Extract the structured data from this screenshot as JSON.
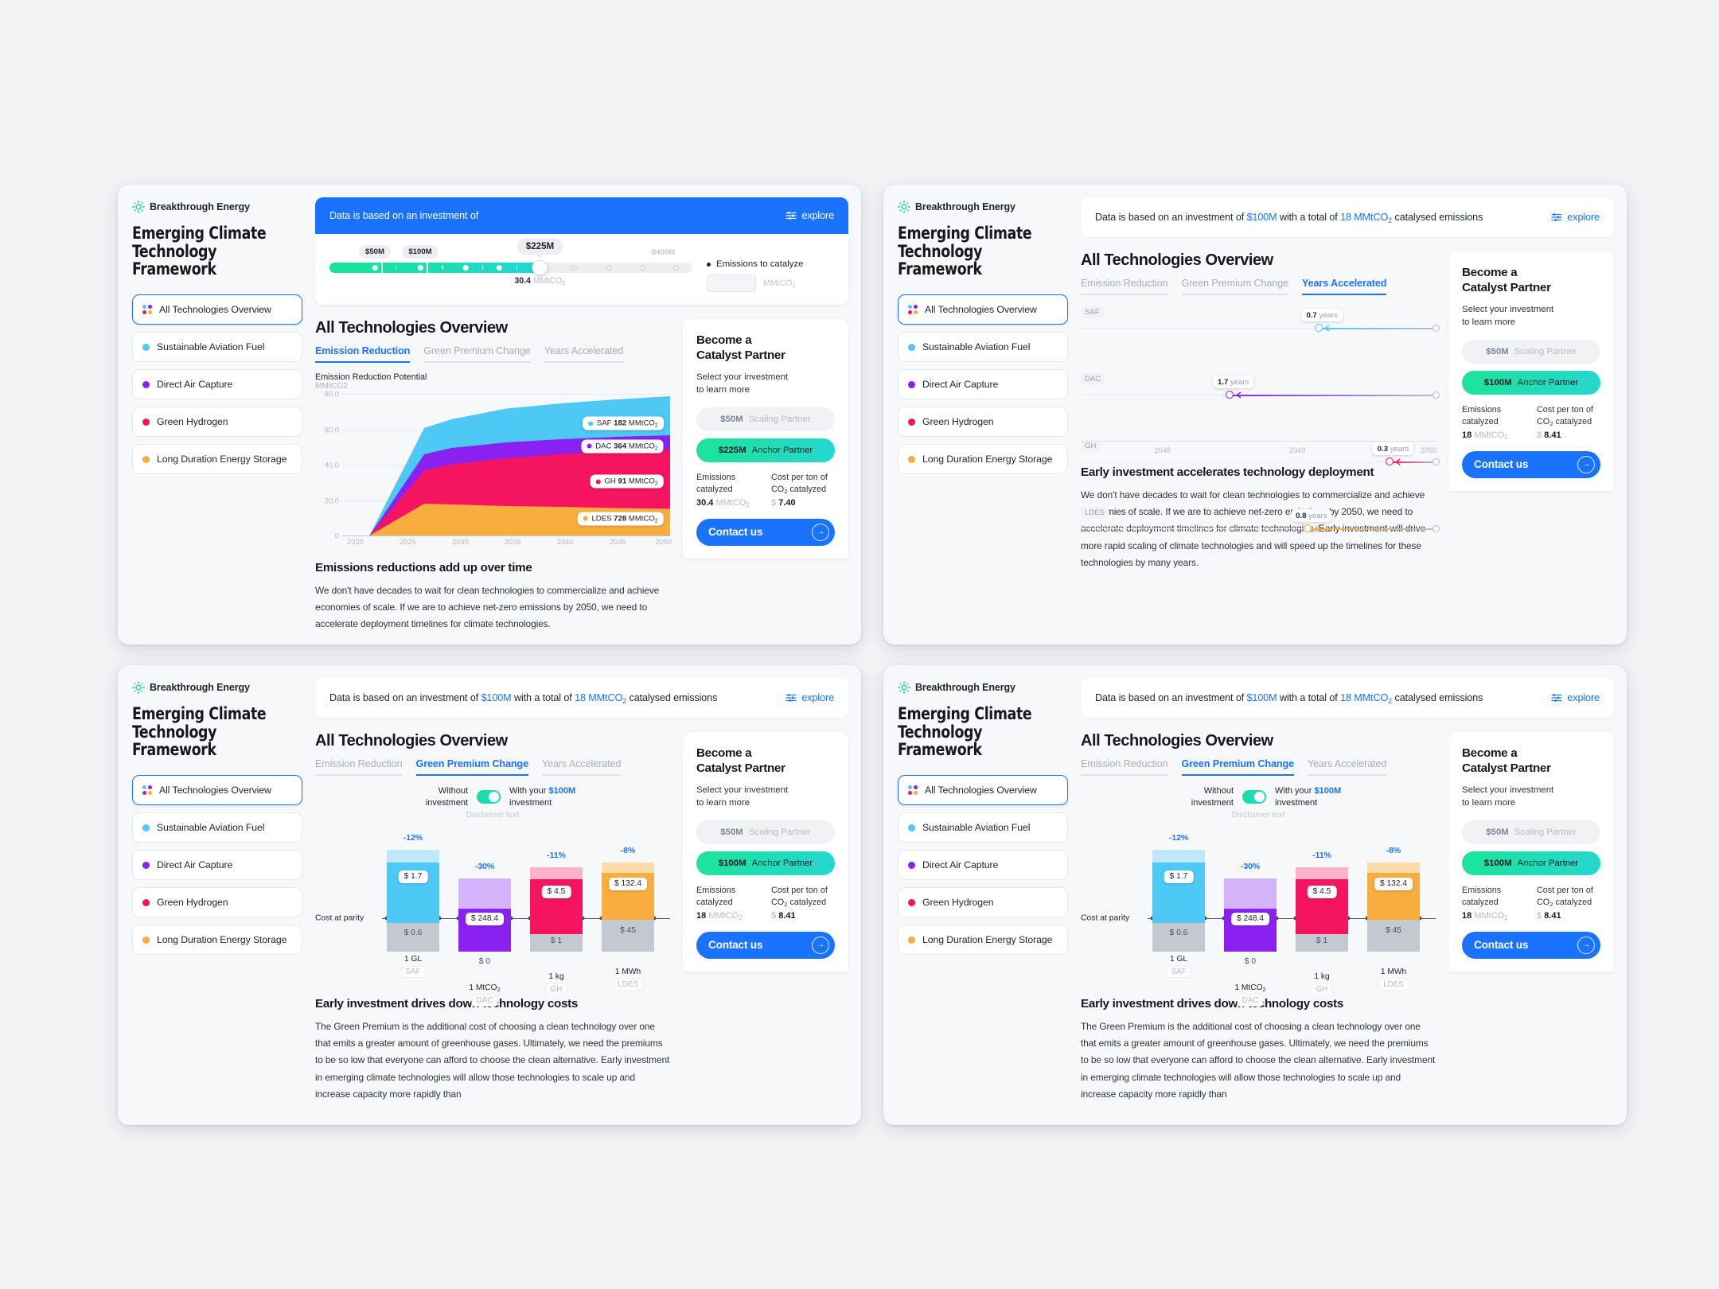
{
  "brand": {
    "name": "Breakthrough Energy",
    "logo_icon": "sunburst-logo-icon"
  },
  "framework_title": "Emerging Climate\nTechnology Framework",
  "sidebar": {
    "items": [
      {
        "label": "All Technologies Overview",
        "icon": "grid-dots-icon",
        "active": true
      },
      {
        "label": "Sustainable Aviation Fuel",
        "color": "#4ec8f5",
        "active": false
      },
      {
        "label": "Direct Air Capture",
        "color": "#8b21f0",
        "active": false
      },
      {
        "label": "Green Hydrogen",
        "color": "#f5145f",
        "active": false
      },
      {
        "label": "Long Duration Energy Storage",
        "color": "#f9ad3e",
        "active": false
      }
    ]
  },
  "colors": {
    "accent_blue": "#1a73ff",
    "saf": "#4ec8f5",
    "dac": "#8b21f0",
    "gh": "#f5145f",
    "ldes": "#f9ad3e",
    "teal": "#1de39b",
    "grey": "#c3c8d1"
  },
  "header": {
    "blue_prefix": "Data is based on an investment of",
    "white_text_parts": [
      "Data is based on an investment of ",
      "$100M",
      " with a total of ",
      "18 MMtCO",
      "2",
      " catalysed emissions"
    ],
    "investment_value": "$100M",
    "emissions_value": "18 MMtCO",
    "explore_label": "explore",
    "explore_icon": "sliders-icon"
  },
  "slider": {
    "labels": [
      {
        "text": "$50M",
        "pos": 12.5,
        "muted": false
      },
      {
        "text": "$100M",
        "pos": 25.0,
        "muted": false
      },
      {
        "text": "$400M",
        "pos": 92.0,
        "muted": true
      }
    ],
    "current_label": "$225M",
    "current_pos": 58.0,
    "value_number": "30.4",
    "value_unit": "MMtCO",
    "value_unit_sub": "2",
    "ticks_on": [
      12.5,
      25.0,
      37.5,
      46.5
    ],
    "ticks_off": [
      67.5,
      77.0,
      86.0,
      95.5
    ],
    "legend": {
      "title": "Emissions to catalyze",
      "field_value": "",
      "unit": "MMtCO",
      "unit_sub": "2"
    }
  },
  "page_title": "All Technologies Overview",
  "tabs": [
    {
      "label": "Emission Reduction"
    },
    {
      "label": "Green Premium Change"
    },
    {
      "label": "Years Accelerated"
    }
  ],
  "chart_data": [
    {
      "id": "emission_reduction_area",
      "type": "area",
      "title": "Emission Reduction Potential",
      "ylabel": "MMtCO2",
      "xlabel": "",
      "x": [
        2020,
        2025,
        2030,
        2035,
        2040,
        2045,
        2050
      ],
      "ylim": [
        0,
        80
      ],
      "yticks": [
        0,
        20,
        40,
        60,
        80
      ],
      "xticks": [
        2020,
        2025,
        2030,
        2035,
        2040,
        2045,
        2050
      ],
      "grid": true,
      "stacked": true,
      "series": [
        {
          "name": "LDES",
          "color": "#f9ad3e",
          "values": [
            0,
            13.5,
            18.0,
            17.2,
            16.8,
            16.4,
            16.0
          ],
          "label": "LDES 728 MMtCO2",
          "label_value": "728"
        },
        {
          "name": "GH",
          "color": "#f5145f",
          "values": [
            0,
            9.0,
            18.5,
            21.5,
            23.2,
            24.4,
            26.0
          ],
          "label": "GH 91 MMtCO2",
          "label_value": "91"
        },
        {
          "name": "DAC",
          "color": "#8b21f0",
          "values": [
            0,
            3.0,
            9.0,
            10.0,
            10.4,
            10.8,
            11.0
          ],
          "label": "DAC 364 MMtCO2",
          "label_value": "364"
        },
        {
          "name": "SAF",
          "color": "#4ec8f5",
          "values": [
            0,
            4.5,
            15.0,
            17.8,
            20.5,
            23.0,
            25.5
          ],
          "label": "SAF 182 MMtCO2",
          "label_value": "182"
        }
      ]
    },
    {
      "id": "years_accelerated",
      "type": "range",
      "xlim": [
        2047.3,
        2050
      ],
      "xticks": [
        2048,
        2049,
        2050
      ],
      "rows": [
        {
          "name": "SAF",
          "color": "#4ec8f5",
          "years": "0.7",
          "unit": "years",
          "start": 2049.13,
          "end": 2050
        },
        {
          "name": "DAC",
          "color": "#8b21f0",
          "years": "1.7",
          "unit": "years",
          "start": 2048.44,
          "end": 2050
        },
        {
          "name": "GH",
          "color": "#f5145f",
          "years": "0.3",
          "unit": "years",
          "start": 2049.68,
          "end": 2050
        },
        {
          "name": "LDES",
          "color": "#f9ad3e",
          "years": "0.8",
          "unit": "years",
          "start": 2049.05,
          "end": 2050
        }
      ]
    },
    {
      "id": "green_premium_change",
      "type": "bar",
      "toggle": {
        "left": "Without investment",
        "right_pre": "With your ",
        "right_value": "$100M",
        "right_post": " investment",
        "on": true
      },
      "disclaimer": "Disclaimer text",
      "parity_label": "Cost at parity",
      "categories": [
        "SAF",
        "DAC",
        "GH",
        "LDES"
      ],
      "units": [
        "1 GL",
        "1 MtCO2",
        "1 kg",
        "1 MWh"
      ],
      "bars": [
        {
          "name": "SAF",
          "color": "#4ec8f5",
          "light": "#bfe8fa",
          "pct": "-12%",
          "value": "$ 1.7",
          "parity": "$ 0.6"
        },
        {
          "name": "DAC",
          "color": "#8b21f0",
          "light": "#d4b3fa",
          "pct": "-30%",
          "value": "$ 248.4",
          "parity": "$ 0"
        },
        {
          "name": "GH",
          "color": "#f5145f",
          "light": "#fbb2cb",
          "pct": "-11%",
          "value": "$ 4.5",
          "parity": "$ 1"
        },
        {
          "name": "LDES",
          "color": "#f9ad3e",
          "light": "#fcdcab",
          "pct": "-8%",
          "value": "$ 132.4",
          "parity": "$ 45"
        }
      ]
    }
  ],
  "sections": {
    "emission": {
      "title": "Emissions reductions add up over time",
      "body": "We don't have decades to wait for clean technologies to commercialize and achieve economies of scale. If we are to achieve net-zero emissions by 2050, we need to accelerate deployment timelines for climate technologies."
    },
    "years": {
      "title": "Early investment accelerates technology deployment",
      "body": "We don't have decades to wait for clean technologies to commercialize and achieve economies of scale. If we are to achieve net-zero emissions by 2050, we need to accelerate deployment timelines for climate technologies. Early investment will drive more rapid scaling of climate technologies and will speed up the timelines for these technologies by many years."
    },
    "premium": {
      "title": "Early investment drives down technology costs",
      "body": "The Green Premium is the additional cost of choosing a clean technology over one that emits a greater amount of greenhouse gases. Ultimately, we need the premiums to be so low that everyone can afford to choose the clean alternative. Early investment in emerging climate technologies will allow those technologies to scale up and increase capacity more rapidly than"
    }
  },
  "partner": {
    "title": "Become a\nCatalyst Partner",
    "subtitle": "Select your investment\nto learn more",
    "option_scaling": {
      "amount": "$50M",
      "label": "Scaling Partner"
    },
    "option_anchor_225": {
      "amount": "$225M",
      "label": "Anchor Partner"
    },
    "option_anchor_100": {
      "amount": "$100M",
      "label": "Anchor Partner"
    },
    "stat1_key": "Emissions\ncatalyzed",
    "stat2_key": "Cost per ton of\nCO2 catalyzed",
    "stat1_value_225": "30.4",
    "stat1_unit": "MMtCO",
    "stat2_value_225": "7.40",
    "stat1_value_100": "18",
    "stat2_value_100": "8.41",
    "currency": "$",
    "cta_label": "Contact us",
    "cta_icon": "arrow-right-icon"
  }
}
